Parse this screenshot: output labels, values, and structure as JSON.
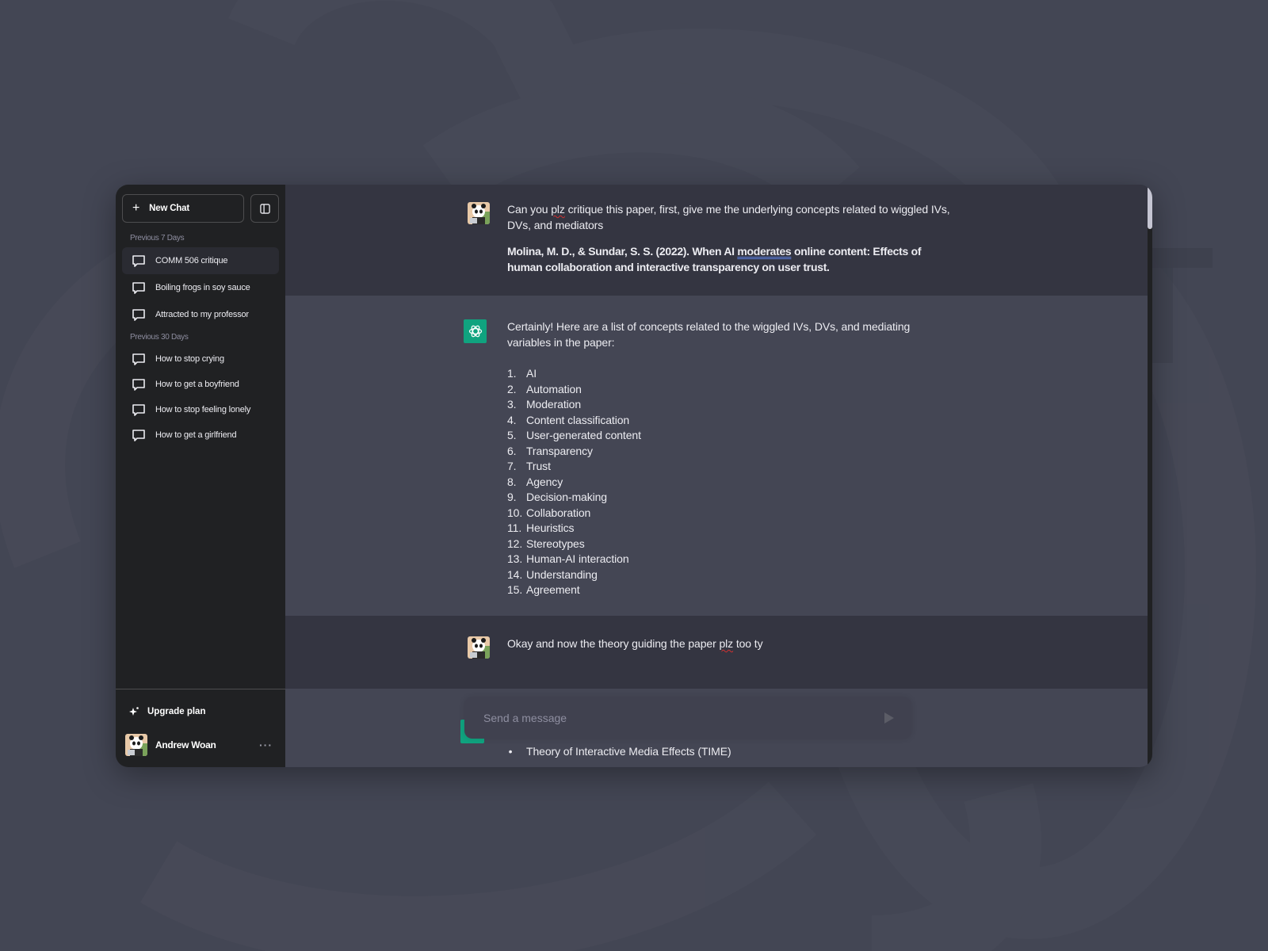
{
  "sidebar": {
    "new_chat_label": "New Chat",
    "sections": [
      {
        "label": "Previous 7 Days",
        "items": [
          {
            "label": "COMM 506 critique",
            "active": true
          },
          {
            "label": "Boiling frogs in soy sauce",
            "active": false
          },
          {
            "label": "Attracted to my professor",
            "active": false
          }
        ]
      },
      {
        "label": "Previous 30 Days",
        "items": [
          {
            "label": "How to stop crying",
            "active": false
          },
          {
            "label": "How to get a boyfriend",
            "active": false
          },
          {
            "label": "How to stop feeling lonely",
            "active": false
          },
          {
            "label": "How to get a girlfriend",
            "active": false
          }
        ]
      }
    ],
    "upgrade_label": "Upgrade plan",
    "user_name": "Andrew Woan",
    "more_label": "···"
  },
  "conversation": {
    "user_message_1": {
      "parts": [
        "Can you ",
        "plz",
        " critique this paper, first, give me the underlying concepts related to wiggled IVs, DVs, and mediators"
      ],
      "citation_parts": [
        "Molina, M. D., & Sundar, S. S. (2022). When AI ",
        "moderates",
        " online content: Effects of human collaboration and interactive transparency on user trust."
      ]
    },
    "assistant_message_1": {
      "intro": "Certainly! Here are a list of concepts related to the wiggled IVs, DVs, and mediating variables in the paper:",
      "items": [
        {
          "num": "1.",
          "text": "AI"
        },
        {
          "num": "2.",
          "text": "Automation"
        },
        {
          "num": "3.",
          "text": "Moderation"
        },
        {
          "num": "4.",
          "text": "Content classification"
        },
        {
          "num": "5.",
          "text": "User-generated content"
        },
        {
          "num": "6.",
          "text": "Transparency"
        },
        {
          "num": "7.",
          "text": "Trust"
        },
        {
          "num": "8.",
          "text": "Agency"
        },
        {
          "num": "9.",
          "text": "Decision-making"
        },
        {
          "num": "10.",
          "text": "Collaboration"
        },
        {
          "num": "11.",
          "text": "Heuristics"
        },
        {
          "num": "12.",
          "text": "Stereotypes"
        },
        {
          "num": "13.",
          "text": "Human-AI interaction"
        },
        {
          "num": "14.",
          "text": "Understanding"
        },
        {
          "num": "15.",
          "text": "Agreement"
        }
      ]
    },
    "user_message_2": {
      "parts": [
        "Okay and now the theory guiding the paper ",
        "plz",
        " too ty"
      ]
    },
    "assistant_message_2": {
      "bullet": "•",
      "first_item": "Theory of Interactive Media Effects (TIME)"
    }
  },
  "composer": {
    "placeholder": "Send a message",
    "value": ""
  },
  "colors": {
    "accent_green": "#10a37f",
    "sidebar_bg": "#202123",
    "user_msg_bg": "#343541",
    "assistant_msg_bg": "#444654"
  }
}
